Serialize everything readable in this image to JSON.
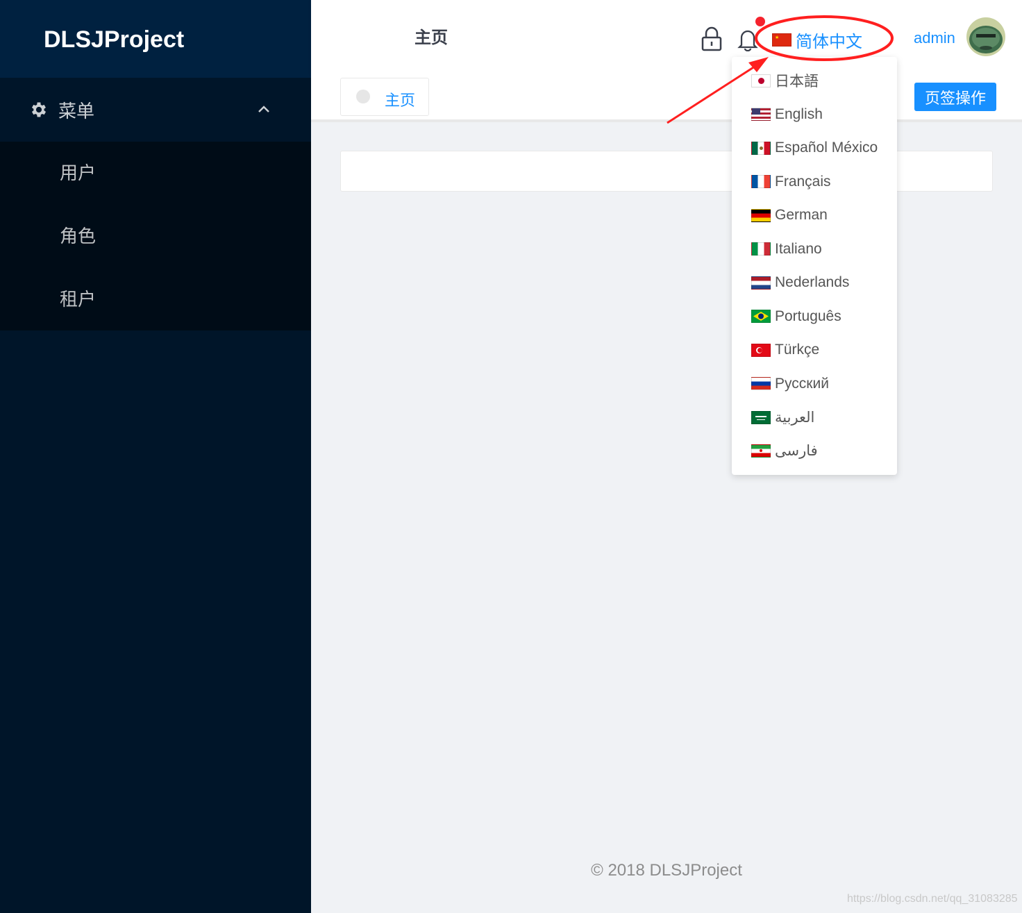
{
  "app": {
    "title": "DLSJProject"
  },
  "sidebar": {
    "menu_label": "菜单",
    "items": [
      {
        "label": "用户"
      },
      {
        "label": "角色"
      },
      {
        "label": "租户"
      }
    ]
  },
  "header": {
    "page_title": "主页",
    "current_language": "简体中文",
    "current_language_flag": "china",
    "user_name": "admin"
  },
  "tabs": {
    "items": [
      {
        "label": "主页"
      }
    ],
    "operations_label": "页签操作"
  },
  "language_menu": {
    "options": [
      {
        "label": "日本語",
        "flag": "japan"
      },
      {
        "label": "English",
        "flag": "usa"
      },
      {
        "label": "Español México",
        "flag": "mexico"
      },
      {
        "label": "Français",
        "flag": "france"
      },
      {
        "label": "German",
        "flag": "germany"
      },
      {
        "label": "Italiano",
        "flag": "italy"
      },
      {
        "label": "Nederlands",
        "flag": "netherlands"
      },
      {
        "label": "Português",
        "flag": "brazil"
      },
      {
        "label": "Türkçe",
        "flag": "turkey"
      },
      {
        "label": "Русский",
        "flag": "russia"
      },
      {
        "label": "العربية",
        "flag": "saudi-arabia"
      },
      {
        "label": "فارسی",
        "flag": "iran"
      }
    ]
  },
  "footer": {
    "text": "© 2018 DLSJProject"
  },
  "watermark": {
    "text": "https://blog.csdn.net/qq_31083285"
  },
  "colors": {
    "sidebar_bg": "#001529",
    "primary": "#1890ff",
    "annotation": "#ff1f1f"
  }
}
